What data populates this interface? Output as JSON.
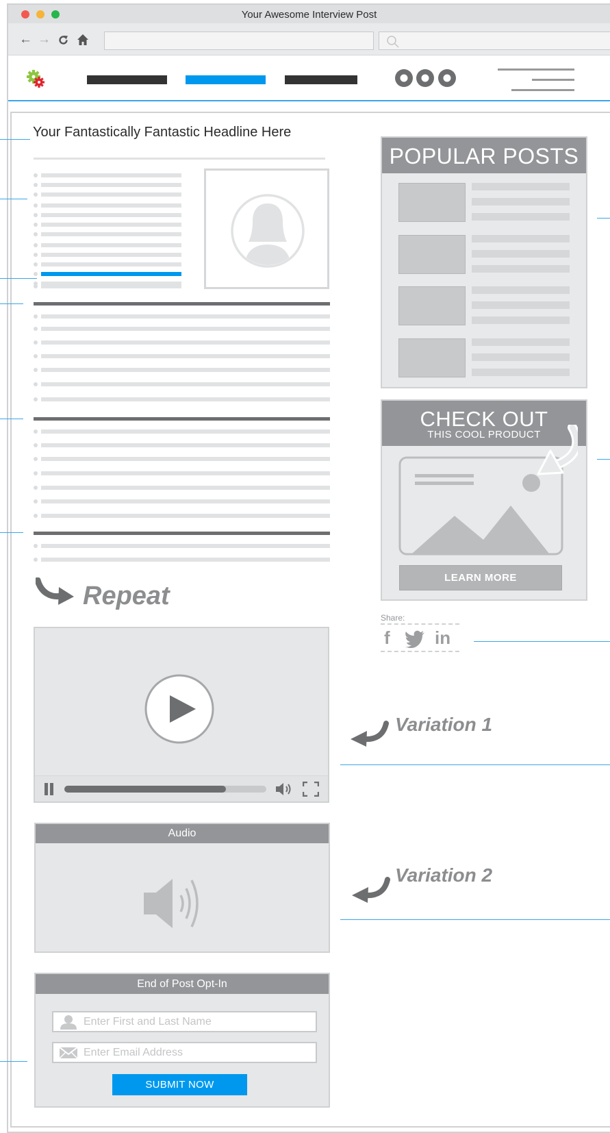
{
  "browser": {
    "title": "Your Awesome Interview Post",
    "window_controls": {
      "close_color": "#f35a4f",
      "minimize_color": "#f5b43a",
      "maximize_color": "#26b64b"
    },
    "toolbar": {
      "back_icon": "arrow-left-icon",
      "forward_icon": "arrow-right-icon",
      "reload_icon": "reload-icon",
      "home_icon": "home-icon",
      "search_icon": "search-icon"
    }
  },
  "site_header": {
    "logo_icon": "gear-logo-icon",
    "nav_colors": {
      "default": "#333333",
      "active": "#0098ee"
    }
  },
  "article": {
    "headline": "Your Fantastically Fantastic Headline Here",
    "repeat_label": "Repeat"
  },
  "sidebar": {
    "popular_posts_title": "POPULAR POSTS",
    "product_title": "CHECK OUT",
    "product_subtitle": "THIS COOL PRODUCT",
    "learn_more_label": "LEARN MORE",
    "share_label": "Share:",
    "share_icons": [
      "facebook-icon",
      "twitter-icon",
      "linkedin-icon"
    ],
    "facebook_glyph": "f",
    "linkedin_glyph": "in"
  },
  "media": {
    "variation1_label": "Variation 1",
    "variation2_label": "Variation 2",
    "video_progress": 0.8,
    "audio_title": "Audio"
  },
  "optin": {
    "title": "End of Post Opt-In",
    "name_placeholder": "Enter First and Last Name",
    "email_placeholder": "Enter Email Address",
    "submit_label": "SUBMIT NOW"
  },
  "colors": {
    "accent": "#0098ee",
    "annotation_line": "#3aa6e9",
    "panel_header": "#939598"
  }
}
